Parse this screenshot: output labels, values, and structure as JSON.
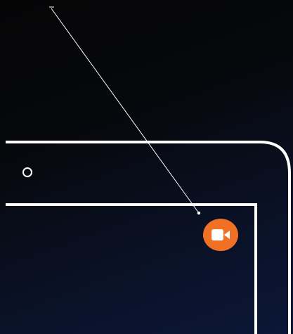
{
  "device": {
    "camera": {
      "icon": "front-camera-icon"
    }
  },
  "callout": {
    "icon": "video-camera-icon",
    "badge_color": "#f07125"
  },
  "colors": {
    "outline": "#ffffff",
    "background_top": "#050506",
    "background_bottom": "#0b1738"
  }
}
